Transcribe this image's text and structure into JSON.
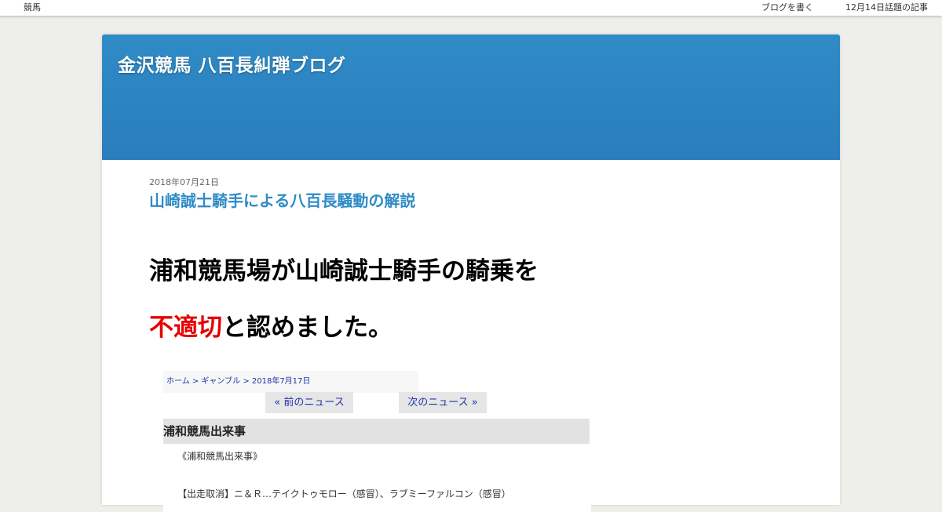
{
  "topbar": {
    "category": "競馬",
    "write_blog": "ブログを書く",
    "topic": "12月14日話題の記事"
  },
  "header": {
    "blog_title": "金沢競馬 八百長糾弾ブログ"
  },
  "post": {
    "date": "2018年07月21日",
    "title": "山崎誠士騎手による八百長騒動の解説",
    "headline_line1": "浦和競馬場が山崎誠士騎手の騎乗を",
    "headline_line2_red": "不適切",
    "headline_line2_rest": "と認めました。"
  },
  "embed": {
    "breadcrumb": "ホーム > ギャンブル > 2018年7月17日",
    "prev_label": "« 前のニュース",
    "next_label": "次のニュース »",
    "section_title": "浦和競馬出来事",
    "section_sub": "《浦和競馬出来事》",
    "news_line": "【出走取消】ニ＆Ｒ…テイクトゥモロー（感冒）、ラブミーファルコン（感冒）"
  },
  "colors": {
    "header_blue": "#2f8bc6",
    "title_link": "#2f8bc6",
    "highlight_red": "#e60000",
    "page_bg": "#eeeeea"
  }
}
